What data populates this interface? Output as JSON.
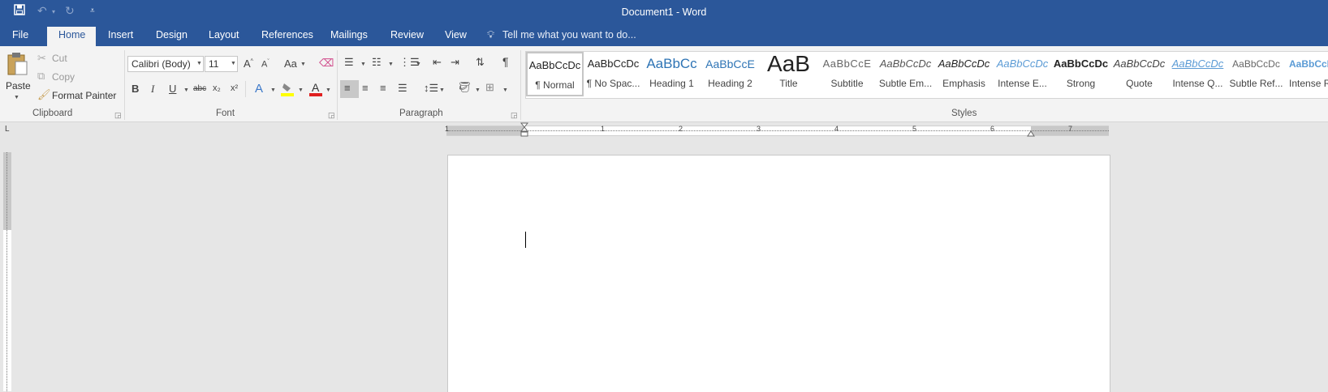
{
  "window": {
    "title": "Document1 - Word"
  },
  "qat": {
    "save": "save-icon",
    "undo": "undo-icon",
    "redo": "redo-icon",
    "customize": "customize-icon"
  },
  "tabs": [
    "File",
    "Home",
    "Insert",
    "Design",
    "Layout",
    "References",
    "Mailings",
    "Review",
    "View"
  ],
  "tell_me": "Tell me what you want to do...",
  "clipboard": {
    "paste": "Paste",
    "cut": "Cut",
    "copy": "Copy",
    "format_painter": "Format Painter",
    "group_label": "Clipboard"
  },
  "font": {
    "family": "Calibri (Body)",
    "size": "11",
    "change_case": "Aa",
    "bold": "B",
    "italic": "I",
    "underline": "U",
    "strikethrough": "abc",
    "subscript": "x₂",
    "superscript": "x²",
    "group_label": "Font"
  },
  "paragraph": {
    "group_label": "Paragraph",
    "pilcrow": "¶"
  },
  "styles": {
    "group_label": "Styles",
    "items": [
      {
        "sample": "AaBbCcDc",
        "label": "¶ Normal"
      },
      {
        "sample": "AaBbCcDc",
        "label": "¶ No Spac..."
      },
      {
        "sample": "AaBbCc",
        "label": "Heading 1"
      },
      {
        "sample": "AaBbCcE",
        "label": "Heading 2"
      },
      {
        "sample": "AaB",
        "label": "Title"
      },
      {
        "sample": "AaBbCcE",
        "label": "Subtitle"
      },
      {
        "sample": "AaBbCcDc",
        "label": "Subtle Em..."
      },
      {
        "sample": "AaBbCcDc",
        "label": "Emphasis"
      },
      {
        "sample": "AaBbCcDc",
        "label": "Intense E..."
      },
      {
        "sample": "AaBbCcDc",
        "label": "Strong"
      },
      {
        "sample": "AaBbCcDc",
        "label": "Quote"
      },
      {
        "sample": "AaBbCcDc",
        "label": "Intense Q..."
      },
      {
        "sample": "AaBbCcDc",
        "label": "Subtle Ref..."
      },
      {
        "sample": "AaBbCcDc",
        "label": "Intense R"
      }
    ]
  },
  "ruler": {
    "numbers": [
      "1",
      "1",
      "2",
      "3",
      "4",
      "5",
      "6",
      "7"
    ],
    "tab_selector": "L"
  },
  "colors": {
    "brand": "#2b579a",
    "highlight": "#ffff00",
    "font_color": "#e02020"
  }
}
